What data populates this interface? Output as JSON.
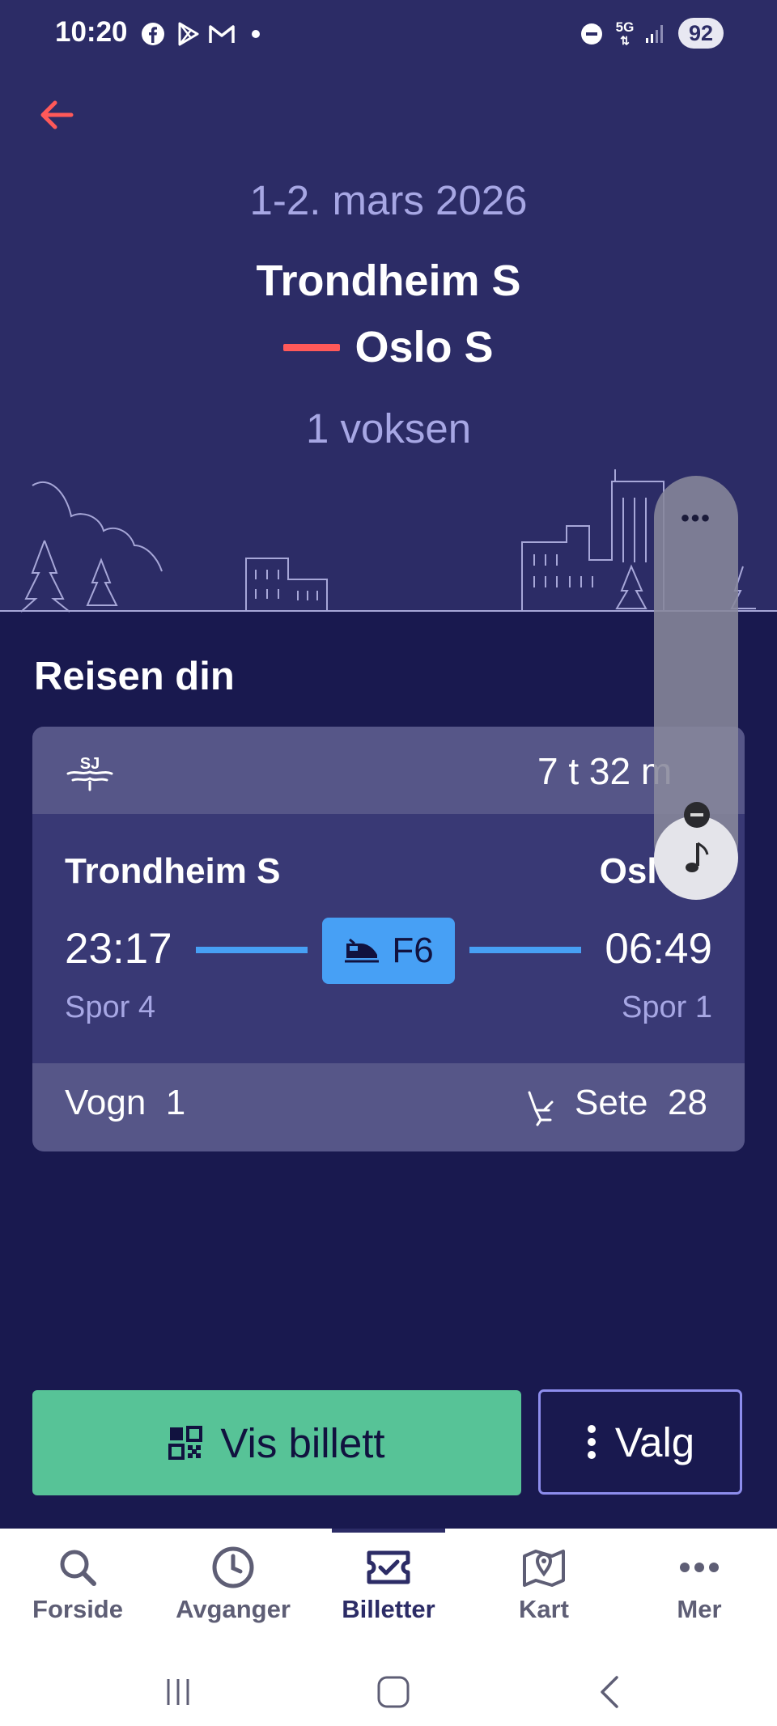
{
  "status_bar": {
    "time": "10:20",
    "network": "5G",
    "battery": "92",
    "icons": [
      "facebook-icon",
      "play-store-icon",
      "gmail-icon",
      "dot-icon",
      "do-not-disturb-icon",
      "signal-icon"
    ]
  },
  "header": {
    "date": "1-2. mars 2026",
    "from": "Trondheim S",
    "to": "Oslo S",
    "passengers": "1 voksen",
    "accent": "#ff5959"
  },
  "trip": {
    "section_title": "Reisen din",
    "operator_logo": "SJ",
    "duration": "7 t 32 m",
    "from_station": "Trondheim S",
    "to_station": "Oslo S",
    "departure_time": "23:17",
    "arrival_time": "06:49",
    "departure_track": "Spor 4",
    "arrival_track": "Spor 1",
    "train_line": "F6",
    "wagon_label": "Vogn",
    "wagon_number": "1",
    "seat_label": "Sete",
    "seat_number": "28"
  },
  "actions": {
    "show_ticket": "Vis billett",
    "options": "Valg"
  },
  "nav": {
    "items": [
      {
        "label": "Forside",
        "icon": "search-icon"
      },
      {
        "label": "Avganger",
        "icon": "clock-icon"
      },
      {
        "label": "Billetter",
        "icon": "ticket-icon",
        "active": true
      },
      {
        "label": "Kart",
        "icon": "map-icon"
      },
      {
        "label": "Mer",
        "icon": "more-icon"
      }
    ]
  },
  "colors": {
    "header_bg": "#2c2c66",
    "page_bg": "#19194f",
    "card_bg": "#393975",
    "card_band": "#565688",
    "primary_button": "#57c397",
    "line_blue": "#47a0f5",
    "muted_text": "#a7a7e4"
  }
}
